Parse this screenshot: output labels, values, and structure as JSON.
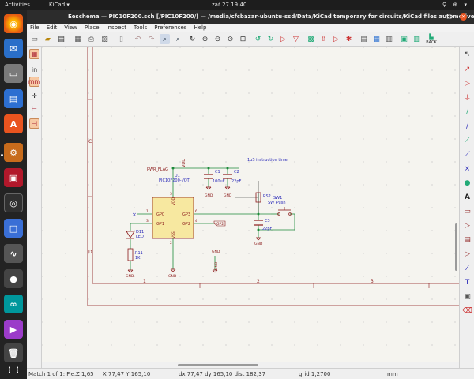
{
  "system_bar": {
    "activities": "Activities",
    "app_name": "KiCad ▾",
    "clock": "zář 27  19:40",
    "tray": "⚲ ⊕ ▾"
  },
  "window": {
    "title": "Eeschema — PIC10F200.sch [/PIC10F200/] — /media/cfcbazar-ubuntu-ssd/Data/KiCad temporary for circuits/KiCad files automotive flasher",
    "minimize": "–",
    "maximize": "□",
    "close": "×"
  },
  "menu": [
    "File",
    "Edit",
    "View",
    "Place",
    "Inspect",
    "Tools",
    "Preferences",
    "Help"
  ],
  "toolbar": {
    "back_label": "BACK",
    "icons": [
      "new-sheet-icon",
      "open-icon",
      "save-icon",
      "page-settings-icon",
      "print-icon",
      "plot-icon",
      "paste-icon",
      "undo-icon",
      "redo-icon",
      "find-icon",
      "find-replace-icon",
      "refresh-icon",
      "zoom-in-icon",
      "zoom-out-icon",
      "zoom-fit-icon",
      "zoom-selection-icon",
      "rotate-ccw-icon",
      "rotate-cw-icon",
      "mirror-v-icon",
      "mirror-h-icon",
      "hierarchy-icon",
      "leave-sheet-icon",
      "symbol-editor-icon",
      "symbol-browser-icon",
      "annotate-icon",
      "erc-icon",
      "footprint-assign-icon",
      "netlist-icon",
      "bom-icon",
      "pcbnew-icon"
    ]
  },
  "schematic": {
    "border_letters": [
      "C",
      "D"
    ],
    "border_numbers": [
      "1",
      "2",
      "3"
    ],
    "net_note": "1uS instruction time",
    "pwr_flag": "PWR_FLAG",
    "vdd_label": "VDD",
    "u1_ref": "U1",
    "u1_value": "PIC10F200-I/OT",
    "c1_ref": "C1",
    "c1_value": "100uF",
    "c2_ref": "C2",
    "c2_value": "22pF",
    "gnd": "GND",
    "rs2_ref": "RS2",
    "sw1_ref": "SW1",
    "sw1_value": "SW_Push",
    "c3_ref": "C3",
    "c3_value": "22pF",
    "d11_ref": "D11",
    "d11_value": "LED",
    "r11_ref": "R11",
    "r11_value": "1K",
    "gp0": "GP0",
    "gp1": "GP1",
    "gp2": "GP2",
    "gp3": "GP3",
    "vdd_pin": "VDD",
    "vss_pin": "VSS",
    "gp2_net": "GP2",
    "pin_5": "5",
    "pin_2": "2",
    "pin_6": "6",
    "pin_4": "4",
    "pin_1": "1",
    "pin_3": "3",
    "no_connect": "×"
  },
  "status": {
    "match": "Match 1 of 1: Fie...",
    "zoom": "Z 1,65",
    "xy": "X 77,47  Y 165,10",
    "delta": "dx 77,47  dy 165,10  dist 182,37",
    "grid": "grid 1,2700",
    "units": "mm"
  },
  "colors": {
    "wire": "#1d8a3a",
    "symbol_body": "#f7e8a0",
    "symbol_outline": "#8b1a1a",
    "text_blue": "#2a2ab8",
    "sheet_border": "#8b1a1a"
  }
}
